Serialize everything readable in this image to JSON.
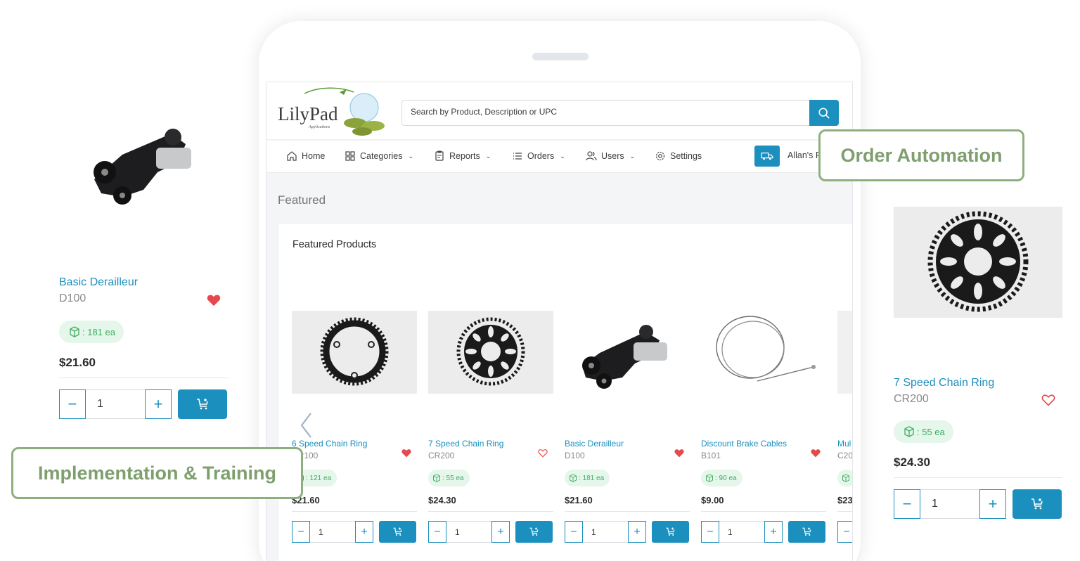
{
  "app": {
    "logo_text": "LilyPad",
    "logo_sub": "Applications",
    "search_placeholder": "Search by Product, Description or UPC",
    "nav": [
      {
        "label": "Home",
        "icon": "home-icon"
      },
      {
        "label": "Categories",
        "icon": "grid-icon"
      },
      {
        "label": "Reports",
        "icon": "report-icon"
      },
      {
        "label": "Orders",
        "icon": "list-icon"
      },
      {
        "label": "Users",
        "icon": "users-icon"
      },
      {
        "label": "Settings",
        "icon": "gear-icon"
      }
    ],
    "account_label": "Allan's F",
    "section_heading": "Featured",
    "panel_title": "Featured Products"
  },
  "products": [
    {
      "name": "6 Speed Chain Ring",
      "code": "CR100",
      "stock": ": 121 ea",
      "price": "$21.60",
      "qty": "1",
      "favorite": true
    },
    {
      "name": "7 Speed Chain Ring",
      "code": "CR200",
      "stock": ": 55 ea",
      "price": "$24.30",
      "qty": "1",
      "favorite": false
    },
    {
      "name": "Basic Derailleur",
      "code": "D100",
      "stock": ": 181 ea",
      "price": "$21.60",
      "qty": "1",
      "favorite": true
    },
    {
      "name": "Discount Brake Cables",
      "code": "B101",
      "stock": ": 90 ea",
      "price": "$9.00",
      "qty": "1",
      "favorite": true
    },
    {
      "name": "Mul",
      "code": "C20",
      "stock": "",
      "price": "$23",
      "qty": "",
      "favorite": false
    }
  ],
  "left_card": {
    "name": "Basic Derailleur",
    "code": "D100",
    "stock": ": 181 ea",
    "price": "$21.60",
    "qty": "1",
    "favorite": true
  },
  "right_card": {
    "name": "7 Speed Chain Ring",
    "code": "CR200",
    "stock": ": 55 ea",
    "price": "$24.30",
    "qty": "1",
    "favorite": false
  },
  "callouts": {
    "order_automation": "Order Automation",
    "implementation": "Implementation & Training"
  },
  "colors": {
    "accent": "#1b8fbd",
    "stock_green": "#3fae62",
    "callout_green": "#8fae7f",
    "heart_red": "#e5484d"
  }
}
